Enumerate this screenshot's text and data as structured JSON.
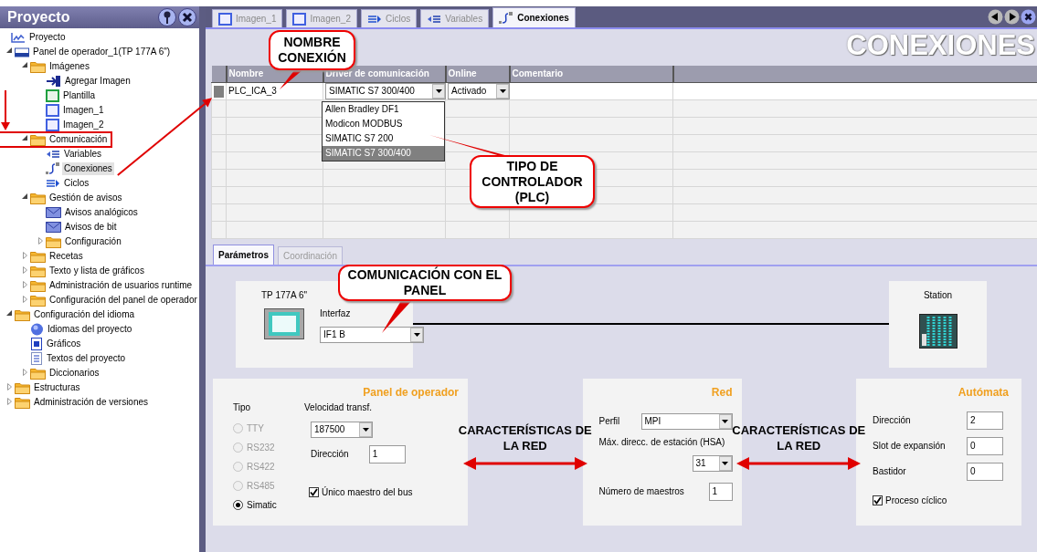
{
  "project_panel": {
    "title": "Proyecto",
    "tree": [
      {
        "label": "Proyecto",
        "kind": "project",
        "selected": false,
        "children": [
          {
            "label": "Panel de operador_1(TP 177A 6\")",
            "kind": "panel",
            "selected": false,
            "expanded": true,
            "children": [
              {
                "label": "Imágenes",
                "kind": "folder",
                "selected": false,
                "expanded": true,
                "children": [
                  {
                    "label": "Agregar Imagen",
                    "kind": "add",
                    "selected": false
                  },
                  {
                    "label": "Plantilla",
                    "kind": "template",
                    "selected": false
                  },
                  {
                    "label": "Imagen_1",
                    "kind": "screen",
                    "selected": false
                  },
                  {
                    "label": "Imagen_2",
                    "kind": "screen",
                    "selected": false
                  }
                ]
              },
              {
                "label": "Comunicación",
                "kind": "folder",
                "selected": false,
                "expanded": true,
                "children": [
                  {
                    "label": "Variables",
                    "kind": "tags",
                    "selected": false
                  },
                  {
                    "label": "Conexiones",
                    "kind": "connection",
                    "selected": true
                  },
                  {
                    "label": "Ciclos",
                    "kind": "cycle",
                    "selected": false
                  }
                ]
              },
              {
                "label": "Gestión de avisos",
                "kind": "folder",
                "selected": false,
                "expanded": true,
                "children": [
                  {
                    "label": "Avisos analógicos",
                    "kind": "alarm",
                    "selected": false
                  },
                  {
                    "label": "Avisos de bit",
                    "kind": "alarm",
                    "selected": false
                  },
                  {
                    "label": "Configuración",
                    "kind": "folder",
                    "selected": false,
                    "expanded": false
                  }
                ]
              },
              {
                "label": "Recetas",
                "kind": "folder",
                "selected": false,
                "expanded": false
              },
              {
                "label": "Texto y lista de gráficos",
                "kind": "folder",
                "selected": false,
                "expanded": false
              },
              {
                "label": "Administración de usuarios runtime",
                "kind": "folder",
                "selected": false,
                "expanded": false
              },
              {
                "label": "Configuración del panel de operador",
                "kind": "folder",
                "selected": false,
                "expanded": false
              }
            ]
          },
          {
            "label": "Configuración del idioma",
            "kind": "folder",
            "selected": false,
            "expanded": true,
            "children": [
              {
                "label": "Idiomas del proyecto",
                "kind": "globe",
                "selected": false
              },
              {
                "label": "Gráficos",
                "kind": "graphics",
                "selected": false
              },
              {
                "label": "Textos del proyecto",
                "kind": "text",
                "selected": false
              },
              {
                "label": "Diccionarios",
                "kind": "folder",
                "selected": false,
                "expanded": false
              }
            ]
          },
          {
            "label": "Estructuras",
            "kind": "folder",
            "selected": false,
            "expanded": false
          },
          {
            "label": "Administración de versiones",
            "kind": "folder",
            "selected": false,
            "expanded": false
          }
        ]
      }
    ]
  },
  "editor_tabs": [
    {
      "label": "Imagen_1",
      "kind": "screen",
      "selected": false
    },
    {
      "label": "Imagen_2",
      "kind": "screen",
      "selected": false
    },
    {
      "label": "Ciclos",
      "kind": "cycle",
      "selected": false
    },
    {
      "label": "Variables",
      "kind": "tags",
      "selected": false
    },
    {
      "label": "Conexiones",
      "kind": "connection",
      "selected": true
    }
  ],
  "editor": {
    "heading": "CONEXIONES",
    "columns": [
      "Nombre",
      "Driver de comunicación",
      "Online",
      "Comentario"
    ],
    "rows": [
      {
        "name": "PLC_ICA_3",
        "driver": "SIMATIC S7 300/400",
        "online": "Activado"
      }
    ],
    "driver_options": [
      {
        "label": "Allen Bradley DF1",
        "selected": false
      },
      {
        "label": "Modicon MODBUS",
        "selected": false
      },
      {
        "label": "SIMATIC S7 200",
        "selected": false
      },
      {
        "label": "SIMATIC S7 300/400",
        "selected": true
      }
    ]
  },
  "param_tabs": [
    {
      "label": "Parámetros",
      "selected": true,
      "disabled": false
    },
    {
      "label": "Coordinación",
      "selected": false,
      "disabled": true
    }
  ],
  "device": {
    "label": "TP 177A 6\"",
    "interface_label": "Interfaz",
    "interface": "IF1 B"
  },
  "station": {
    "label": "Station"
  },
  "operator_panel": {
    "title": "Panel de operador",
    "type_label": "Tipo",
    "types": [
      {
        "label": "TTY",
        "selected": false,
        "disabled": true
      },
      {
        "label": "RS232",
        "selected": false,
        "disabled": true
      },
      {
        "label": "RS422",
        "selected": false,
        "disabled": true
      },
      {
        "label": "RS485",
        "selected": false,
        "disabled": true
      },
      {
        "label": "Simatic",
        "selected": true,
        "disabled": false
      }
    ],
    "speed_label": "Velocidad transf.",
    "speed": "187500",
    "address_label": "Dirección",
    "address": "1",
    "single_master": {
      "label": "Único maestro del bus",
      "checked": true
    }
  },
  "network": {
    "title": "Red",
    "profile_label": "Perfil",
    "profile": "MPI",
    "hsa_label": "Máx. direcc. de estación (HSA)",
    "hsa": "31",
    "masters_label": "Número de maestros",
    "masters": "1"
  },
  "plc": {
    "title": "Autómata",
    "fields": [
      {
        "label": "Dirección",
        "value": "2"
      },
      {
        "label": "Slot de expansión",
        "value": "0"
      },
      {
        "label": "Bastidor",
        "value": "0"
      }
    ],
    "cyclic": {
      "label": "Proceso cíclico",
      "checked": true
    }
  },
  "callouts": [
    {
      "lines": [
        "NOMBRE",
        "CONEXIÓN"
      ]
    },
    {
      "lines": [
        "TIPO DE",
        "CONTROLADOR",
        "(PLC)"
      ]
    },
    {
      "lines": [
        "COMUNICACIÓN CON EL",
        "PANEL"
      ]
    }
  ],
  "link_notes": [
    {
      "lines": [
        "CARACTERÍSTICAS DE",
        "LA RED"
      ]
    },
    {
      "lines": [
        "CARACTERÍSTICAS DE",
        "LA RED"
      ]
    }
  ]
}
